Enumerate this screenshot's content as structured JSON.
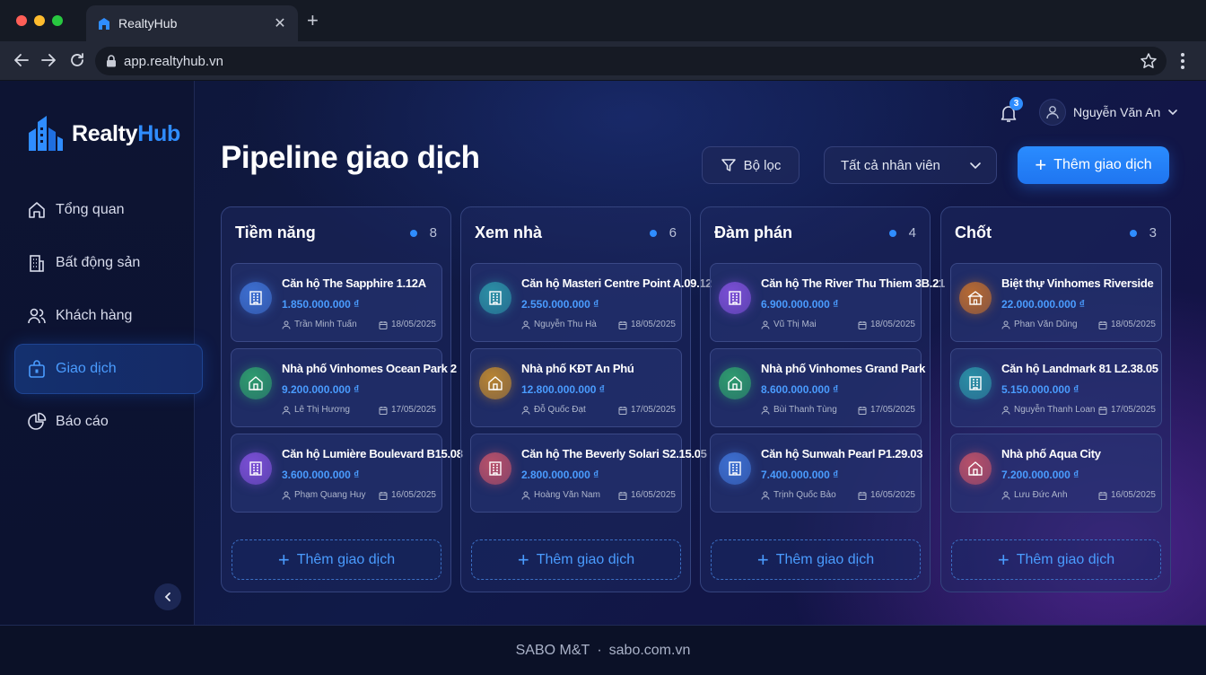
{
  "browser": {
    "tab_title": "RealtyHub",
    "url": "app.realtyhub.vn"
  },
  "brand": {
    "name_part1": "Realty",
    "name_part2": "Hub",
    "accent": "#2f8dff"
  },
  "sidebar": {
    "items": [
      {
        "label": "Tổng quan",
        "icon": "home-icon"
      },
      {
        "label": "Bất động sản",
        "icon": "building-icon"
      },
      {
        "label": "Khách hàng",
        "icon": "users-icon"
      },
      {
        "label": "Giao dịch",
        "icon": "lock-bag-icon",
        "active": true
      },
      {
        "label": "Báo cáo",
        "icon": "pie-chart-icon"
      }
    ]
  },
  "header": {
    "notification_count": "3",
    "user_name": "Nguyễn Văn An",
    "page_title": "Pipeline giao dịch",
    "filter_label": "Bộ lọc",
    "staff_select_value": "Tất cả nhân viên",
    "add_button_label": "Thêm giao dịch"
  },
  "columns": [
    {
      "title": "Tiềm năng",
      "count": "8",
      "cards": [
        {
          "title": "Căn hộ The Sapphire 1.12A",
          "price": "1.850.000.000 ₫",
          "agent": "Trần Minh Tuấn",
          "date": "18/05/2025",
          "icon": "apartment-icon",
          "color": "#3d6fd1"
        },
        {
          "title": "Nhà phố Vinhomes Ocean Park 2",
          "price": "9.200.000.000 ₫",
          "agent": "Lê Thị Hương",
          "date": "17/05/2025",
          "icon": "house-icon",
          "color": "#2e9b6e"
        },
        {
          "title": "Căn hộ Lumière Boulevard B15.08",
          "price": "3.600.000.000 ₫",
          "agent": "Phạm Quang Huy",
          "date": "16/05/2025",
          "icon": "apartment-icon",
          "color": "#7b4fd6"
        }
      ],
      "add_label": "Thêm giao dịch"
    },
    {
      "title": "Xem nhà",
      "count": "6",
      "cards": [
        {
          "title": "Căn hộ Masteri Centre Point A.09.12",
          "price": "2.550.000.000 ₫",
          "agent": "Nguyễn Thu Hà",
          "date": "18/05/2025",
          "icon": "apartment-icon",
          "color": "#2b8fa6"
        },
        {
          "title": "Nhà phố KĐT An Phú",
          "price": "12.800.000.000 ₫",
          "agent": "Đỗ Quốc Đạt",
          "date": "17/05/2025",
          "icon": "house-icon",
          "color": "#b88432"
        },
        {
          "title": "Căn hộ The Beverly Solari S2.15.05",
          "price": "2.800.000.000 ₫",
          "agent": "Hoàng Văn Nam",
          "date": "16/05/2025",
          "icon": "apartment-icon",
          "color": "#b8506a"
        }
      ],
      "add_label": "Thêm giao dịch"
    },
    {
      "title": "Đàm phán",
      "count": "4",
      "cards": [
        {
          "title": "Căn hộ The River Thu Thiem 3B.21",
          "price": "6.900.000.000 ₫",
          "agent": "Vũ Thị Mai",
          "date": "18/05/2025",
          "icon": "apartment-icon",
          "color": "#7b4fd6"
        },
        {
          "title": "Nhà phố Vinhomes Grand Park",
          "price": "8.600.000.000 ₫",
          "agent": "Bùi Thanh Tùng",
          "date": "17/05/2025",
          "icon": "house-icon",
          "color": "#2e9b6e"
        },
        {
          "title": "Căn hộ Sunwah Pearl P1.29.03",
          "price": "7.400.000.000 ₫",
          "agent": "Trịnh Quốc Bảo",
          "date": "16/05/2025",
          "icon": "apartment-icon",
          "color": "#3d6fd1"
        }
      ],
      "add_label": "Thêm giao dịch"
    },
    {
      "title": "Chốt",
      "count": "3",
      "cards": [
        {
          "title": "Biệt thự Vinhomes Riverside",
          "price": "22.000.000.000 ₫",
          "agent": "Phan Văn Dũng",
          "date": "18/05/2025",
          "icon": "villa-icon",
          "color": "#b86a32"
        },
        {
          "title": "Căn hộ Landmark 81 L2.38.05",
          "price": "5.150.000.000 ₫",
          "agent": "Nguyễn Thanh Loan",
          "date": "17/05/2025",
          "icon": "apartment-icon",
          "color": "#2b8fa6"
        },
        {
          "title": "Nhà phố Aqua City",
          "price": "7.200.000.000 ₫",
          "agent": "Lưu Đức Anh",
          "date": "16/05/2025",
          "icon": "house-icon",
          "color": "#b8506a"
        }
      ],
      "add_label": "Thêm giao dịch"
    }
  ],
  "footer": {
    "company": "SABO M&T",
    "separator": "·",
    "website": "sabo.com.vn"
  }
}
